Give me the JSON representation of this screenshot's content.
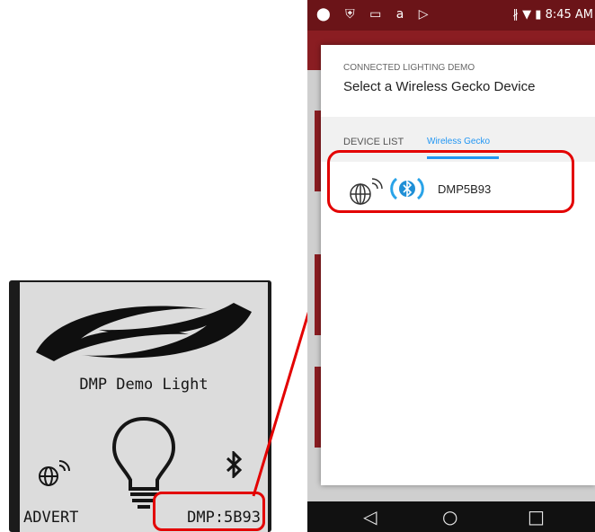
{
  "lcd": {
    "title": "DMP Demo Light",
    "status_left": "ADVERT",
    "status_right": "DMP:5B93"
  },
  "phone": {
    "status_bar": {
      "left_icons": [
        "chrome-icon",
        "shield-icon",
        "image-icon",
        "amazon-icon",
        "play-icon"
      ],
      "left_glyphs": "⬤ ⛨ ▭ a ▷",
      "right_text": "∦ ▼ ▮ 8:45 AM"
    },
    "dialog": {
      "subtitle": "CONNECTED LIGHTING DEMO",
      "title": "Select a Wireless Gecko Device",
      "list_label": "DEVICE LIST",
      "active_tab": "Wireless Gecko",
      "devices": [
        {
          "name": "DMP5B93",
          "icons": [
            "globe-wireless-icon",
            "bluetooth-icon"
          ]
        }
      ]
    },
    "nav": {
      "back": "◁",
      "home": "○",
      "recents": "□"
    }
  },
  "colors": {
    "highlight": "#e30000",
    "status_bar": "#6b1418",
    "app_bar": "#8a1d22",
    "accent_tab": "#2196f3",
    "bluetooth": "#29a3e8"
  }
}
